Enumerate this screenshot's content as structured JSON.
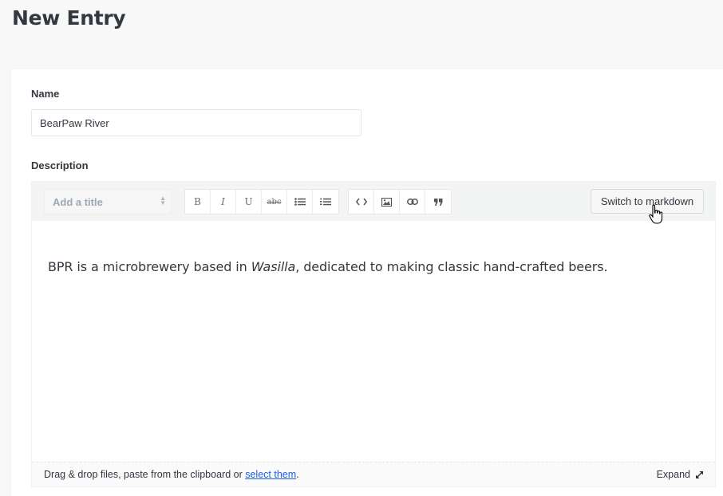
{
  "page": {
    "title": "New Entry"
  },
  "form": {
    "name_label": "Name",
    "name_value": "BearPaw River",
    "description_label": "Description"
  },
  "editor": {
    "toolbar": {
      "title_select": "Add a title",
      "buttons": {
        "bold": "B",
        "italic": "I",
        "underline": "U",
        "strikethrough": "abc"
      },
      "switch_label": "Switch to markdown"
    },
    "content": {
      "before": "BPR is a microbrewery based in ",
      "italic": "Wasilla",
      "after": ", dedicated to making classic hand-crafted beers."
    },
    "footer": {
      "text": "Drag & drop files, paste from the clipboard or ",
      "link": "select them",
      "suffix": ".",
      "expand_label": "Expand"
    }
  }
}
